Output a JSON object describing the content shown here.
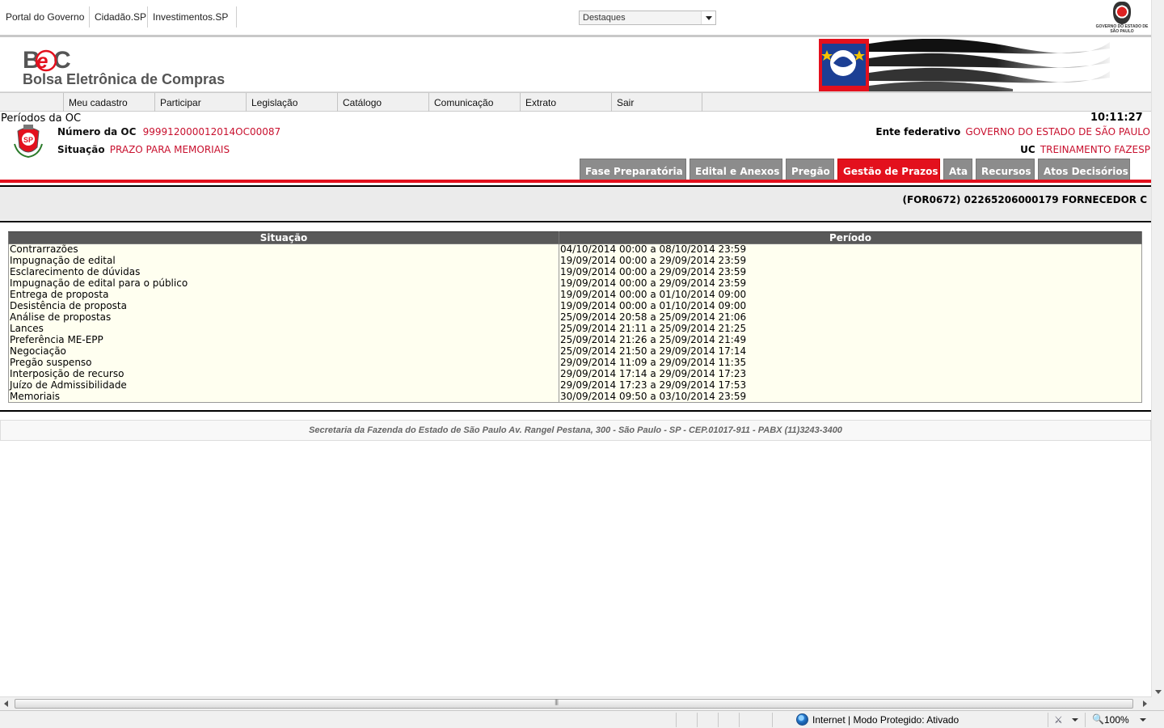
{
  "gov_bar": {
    "links": [
      "Portal do Governo",
      "Cidadão.SP",
      "Investimentos.SP"
    ],
    "destaques": "Destaques",
    "seal_text": "GOVERNO DO ESTADO DE SÃO PAULO"
  },
  "header": {
    "logo_text": "BEC",
    "name": "Bolsa Eletrônica de Compras"
  },
  "menu": [
    "Meu cadastro",
    "Participar",
    "Legislação",
    "Catálogo",
    "Comunicação",
    "Extrato",
    "Sair"
  ],
  "oc": {
    "page_title": "Períodos da OC",
    "clock": "10:11:27",
    "numero_label": "Número da OC",
    "numero_value": "999912000012014OC00087",
    "situacao_label": "Situação",
    "situacao_value": "PRAZO PARA MEMORIAIS",
    "ente_label": "Ente federativo",
    "ente_value": "GOVERNO DO ESTADO DE SÃO PAULO",
    "uc_label": "UC",
    "uc_value": "TREINAMENTO FAZESP"
  },
  "tabs": [
    {
      "label": "Fase Preparatória",
      "active": false
    },
    {
      "label": "Edital e Anexos",
      "active": false
    },
    {
      "label": "Pregão",
      "active": false
    },
    {
      "label": "Gestão de Prazos",
      "active": true
    },
    {
      "label": "Ata",
      "active": false
    },
    {
      "label": "Recursos",
      "active": false
    },
    {
      "label": "Atos Decisórios",
      "active": false
    }
  ],
  "fornecedor": "(FOR0672) 02265206000179 FORNECEDOR C",
  "table": {
    "headers": [
      "Situação",
      "Período"
    ],
    "rows": [
      [
        "Contrarrazões",
        "04/10/2014 00:00 a 08/10/2014 23:59"
      ],
      [
        "Impugnação de edital",
        "19/09/2014 00:00 a 29/09/2014 23:59"
      ],
      [
        "Esclarecimento de dúvidas",
        "19/09/2014 00:00 a 29/09/2014 23:59"
      ],
      [
        "Impugnação de edital para o público",
        "19/09/2014 00:00 a 29/09/2014 23:59"
      ],
      [
        "Entrega de proposta",
        "19/09/2014 00:00 a 01/10/2014 09:00"
      ],
      [
        "Desistência de proposta",
        "19/09/2014 00:00 a 01/10/2014 09:00"
      ],
      [
        "Análise de propostas",
        "25/09/2014 20:58 a 25/09/2014 21:06"
      ],
      [
        "Lances",
        "25/09/2014 21:11 a 25/09/2014 21:25"
      ],
      [
        "Preferência ME-EPP",
        "25/09/2014 21:26 a 25/09/2014 21:49"
      ],
      [
        "Negociação",
        "25/09/2014 21:50 a 29/09/2014 17:14"
      ],
      [
        "Pregão suspenso",
        "29/09/2014 11:09 a 29/09/2014 11:35"
      ],
      [
        "Interposição de recurso",
        "29/09/2014 17:14 a 29/09/2014 17:23"
      ],
      [
        "Juízo de Admissibilidade",
        "29/09/2014 17:23 a 29/09/2014 17:53"
      ],
      [
        "Memoriais",
        "30/09/2014 09:50 a 03/10/2014 23:59"
      ]
    ]
  },
  "footer": "Secretaria da Fazenda do Estado de São Paulo Av. Rangel Pestana, 300 - São Paulo - SP - CEP.01017-911 - PABX (11)3243-3400",
  "status_bar": {
    "zone": "Internet | Modo Protegido: Ativado",
    "zoom": "100%"
  },
  "colors": {
    "accent_red": "#e3101d",
    "value_red": "#c8102e",
    "tab_gray": "#8c8c8c",
    "table_header": "#595959",
    "row_bg": "#fffff0"
  },
  "icons": [
    "globe-icon",
    "security-icon",
    "zoom-icon",
    "chevron-down-icon"
  ]
}
